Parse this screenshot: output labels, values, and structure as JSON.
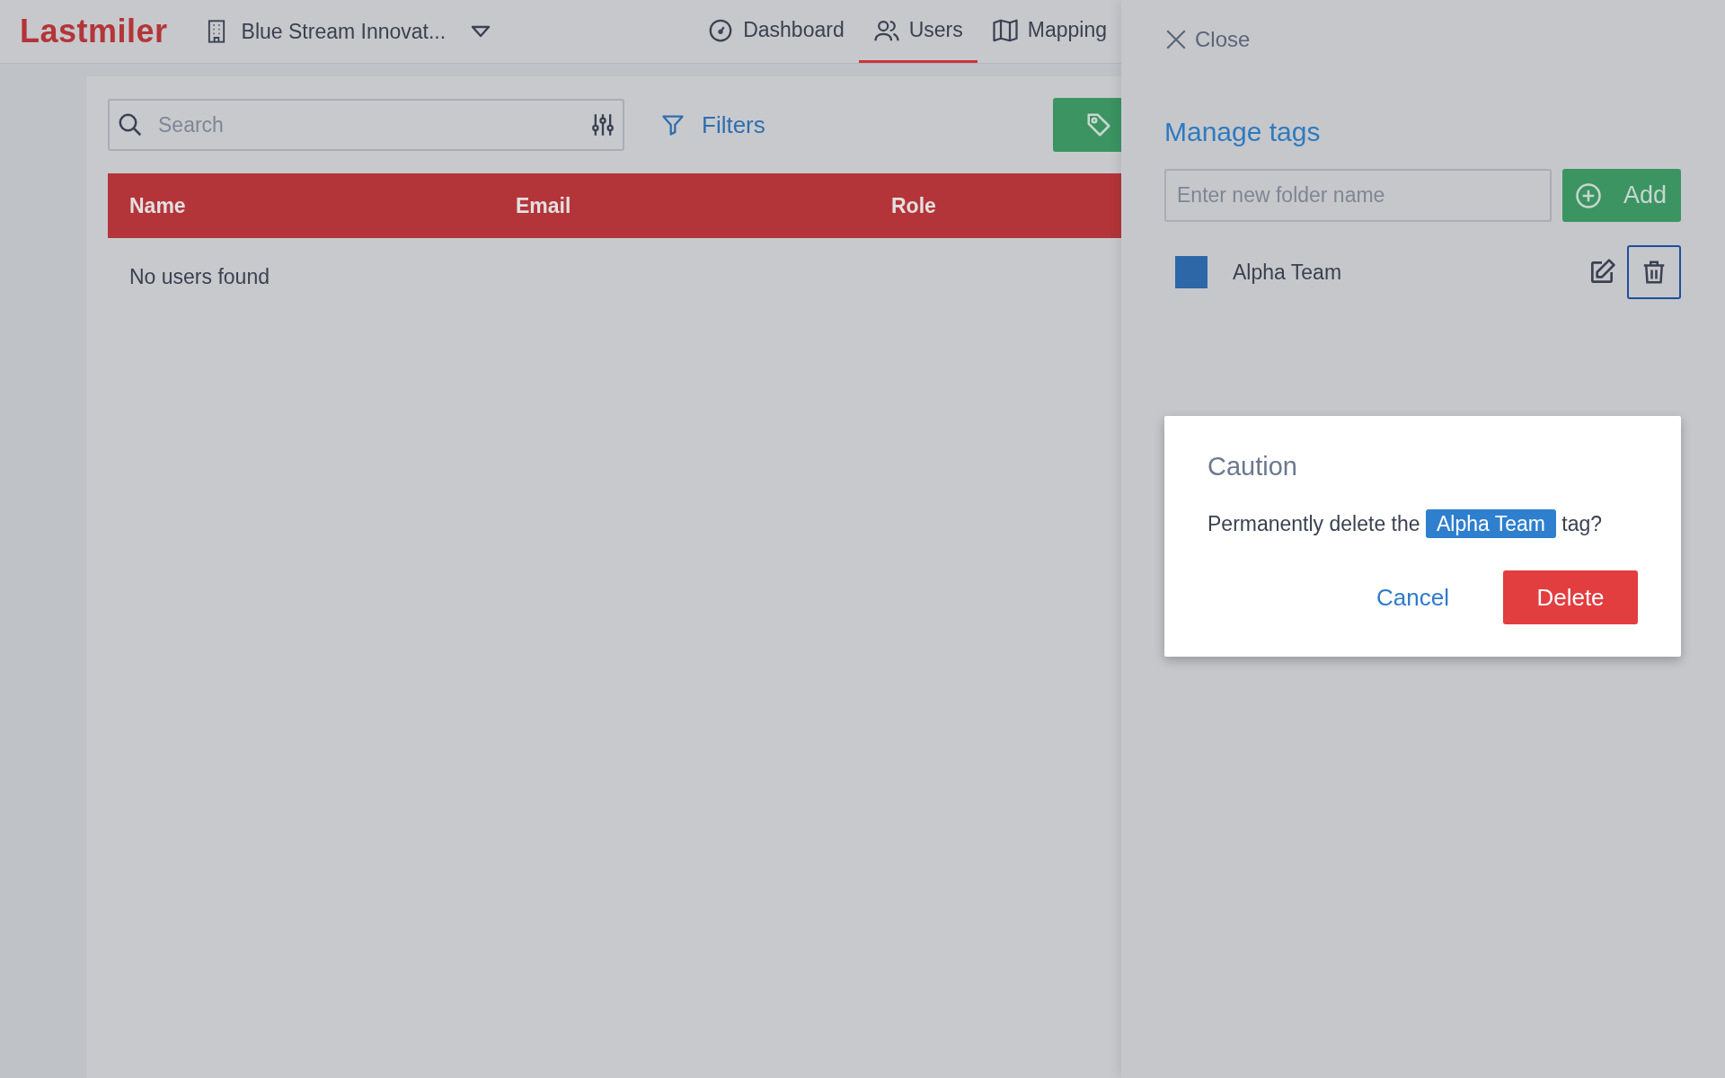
{
  "header": {
    "logo": "Lastmiler",
    "company": "Blue Stream Innovat...",
    "nav": [
      {
        "label": "Dashboard",
        "selected": false
      },
      {
        "label": "Users",
        "selected": true
      },
      {
        "label": "Mapping",
        "selected": false
      }
    ]
  },
  "toolbar": {
    "search": {
      "placeholder": "Search"
    },
    "filters": "Filters"
  },
  "table": {
    "columns": [
      "Name",
      "Email",
      "Role"
    ],
    "empty_message": "No users found"
  },
  "panel": {
    "close": "Close",
    "title": "Manage tags",
    "new_tag": {
      "placeholder": "Enter new folder name"
    },
    "add": "Add",
    "tags": [
      {
        "name": "Alpha Team",
        "color": "#2d67a8",
        "delete_focused": true
      }
    ]
  },
  "dialog": {
    "title": "Caution",
    "message": "Permanently delete the ",
    "tag": "Alpha Team",
    "message_end": " tag?",
    "cancel": "Cancel",
    "confirm": "Delete"
  }
}
